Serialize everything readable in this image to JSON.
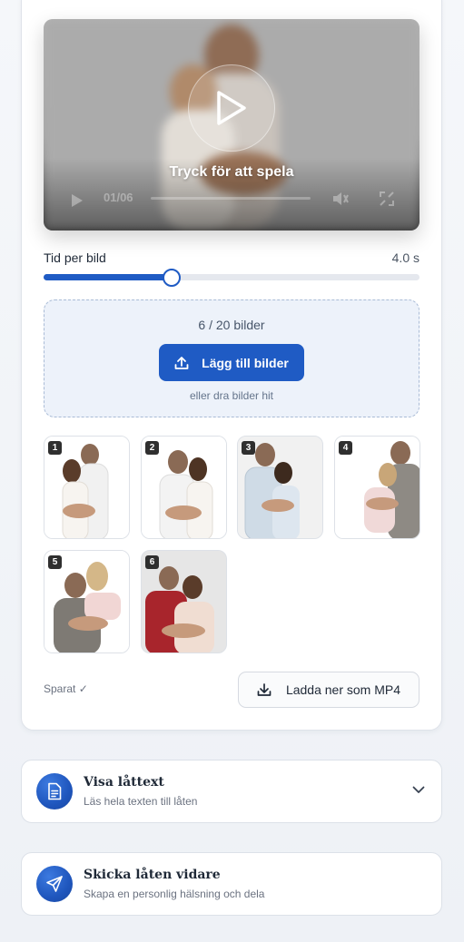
{
  "video": {
    "tap_to_play": "Tryck för att spela",
    "time": "01/06"
  },
  "timing": {
    "label": "Tid per bild",
    "value": "4.0 s",
    "slider_fraction": 0.34
  },
  "upload": {
    "count": "6 / 20 bilder",
    "add_button": "Lägg till bilder",
    "hint": "eller dra bilder hit"
  },
  "thumbnails": [
    "1",
    "2",
    "3",
    "4",
    "5",
    "6"
  ],
  "saved_status": "Sparat ✓",
  "download_button": "Ladda ner som MP4",
  "lyrics_panel": {
    "title": "Visa låttext",
    "subtitle": "Läs hela texten till låten",
    "icon": "document-icon"
  },
  "share_panel": {
    "title": "Skicka låten vidare",
    "subtitle": "Skapa en personlig hälsning och dela",
    "icon": "send-icon"
  },
  "colors": {
    "accent": "#1f5bc4",
    "background": "#f5f7fa"
  }
}
